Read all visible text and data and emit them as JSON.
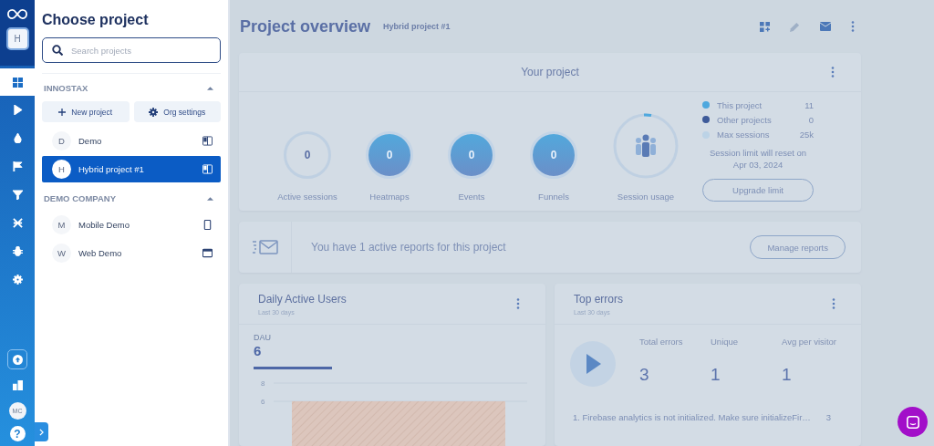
{
  "rail": {
    "avatar": "H",
    "items": [
      {
        "kind": "grid",
        "selected": true
      },
      {
        "kind": "play",
        "selected": false
      },
      {
        "kind": "drop",
        "selected": false
      },
      {
        "kind": "flag",
        "selected": false
      },
      {
        "kind": "filter",
        "selected": false
      },
      {
        "kind": "cross",
        "selected": false
      },
      {
        "kind": "bug",
        "selected": false
      },
      {
        "kind": "gear",
        "selected": false
      }
    ],
    "user": "MC",
    "help": "?"
  },
  "chooser": {
    "title": "Choose project",
    "search": {
      "placeholder": "Search projects"
    },
    "groups": [
      {
        "name": "INNOSTAX",
        "expanded": true,
        "actions": [
          {
            "kind": "plus",
            "label": "New project"
          },
          {
            "kind": "gear",
            "label": "Org settings"
          }
        ],
        "projects": [
          {
            "initial": "D",
            "name": "Demo",
            "kind": "hybrid",
            "selected": false
          },
          {
            "initial": "H",
            "name": "Hybrid project #1",
            "kind": "hybrid",
            "selected": true
          }
        ]
      },
      {
        "name": "DEMO COMPANY",
        "expanded": true,
        "projects": [
          {
            "initial": "M",
            "name": "Mobile Demo",
            "kind": "mobile",
            "selected": false
          },
          {
            "initial": "W",
            "name": "Web Demo",
            "kind": "web",
            "selected": false
          }
        ]
      }
    ]
  },
  "header": {
    "title": "Project overview",
    "project": "Hybrid project #1"
  },
  "your_project": {
    "title": "Your project",
    "stats": [
      {
        "value": "0",
        "label": "Active sessions",
        "kind": "ring"
      },
      {
        "value": "0",
        "label": "Heatmaps",
        "kind": "filled"
      },
      {
        "value": "0",
        "label": "Events",
        "kind": "filled"
      },
      {
        "value": "0",
        "label": "Funnels",
        "kind": "filled"
      }
    ],
    "usage": {
      "label": "Session usage"
    },
    "legend": [
      {
        "label": "This project",
        "value": "11",
        "color": "#4ea8de"
      },
      {
        "label": "Other projects",
        "value": "0",
        "color": "#3d5a99"
      },
      {
        "label": "Max sessions",
        "value": "25k",
        "color": "#bcd3e6"
      }
    ],
    "reset_note": "Session limit will reset on Apr 03, 2024",
    "button": "Upgrade limit"
  },
  "reports": {
    "text": "You have 1 active reports for this project",
    "button": "Manage reports"
  },
  "dau": {
    "title": "Daily Active Users",
    "subtitle": "Last 30 days",
    "metric": "DAU",
    "value": "6",
    "chart_data": {
      "type": "bar",
      "values": [
        6
      ],
      "yticks": [
        6,
        8
      ],
      "ylim": [
        0,
        8
      ]
    }
  },
  "errors": {
    "title": "Top errors",
    "subtitle": "Last 30 days",
    "stats": [
      {
        "label": "Total errors",
        "value": "3"
      },
      {
        "label": "Unique",
        "value": "1"
      },
      {
        "label": "Avg per visitor",
        "value": "1"
      }
    ],
    "rows": [
      {
        "text": "1. Firebase analytics is not initialized. Make sure initializeFir…",
        "count": "3"
      }
    ]
  }
}
